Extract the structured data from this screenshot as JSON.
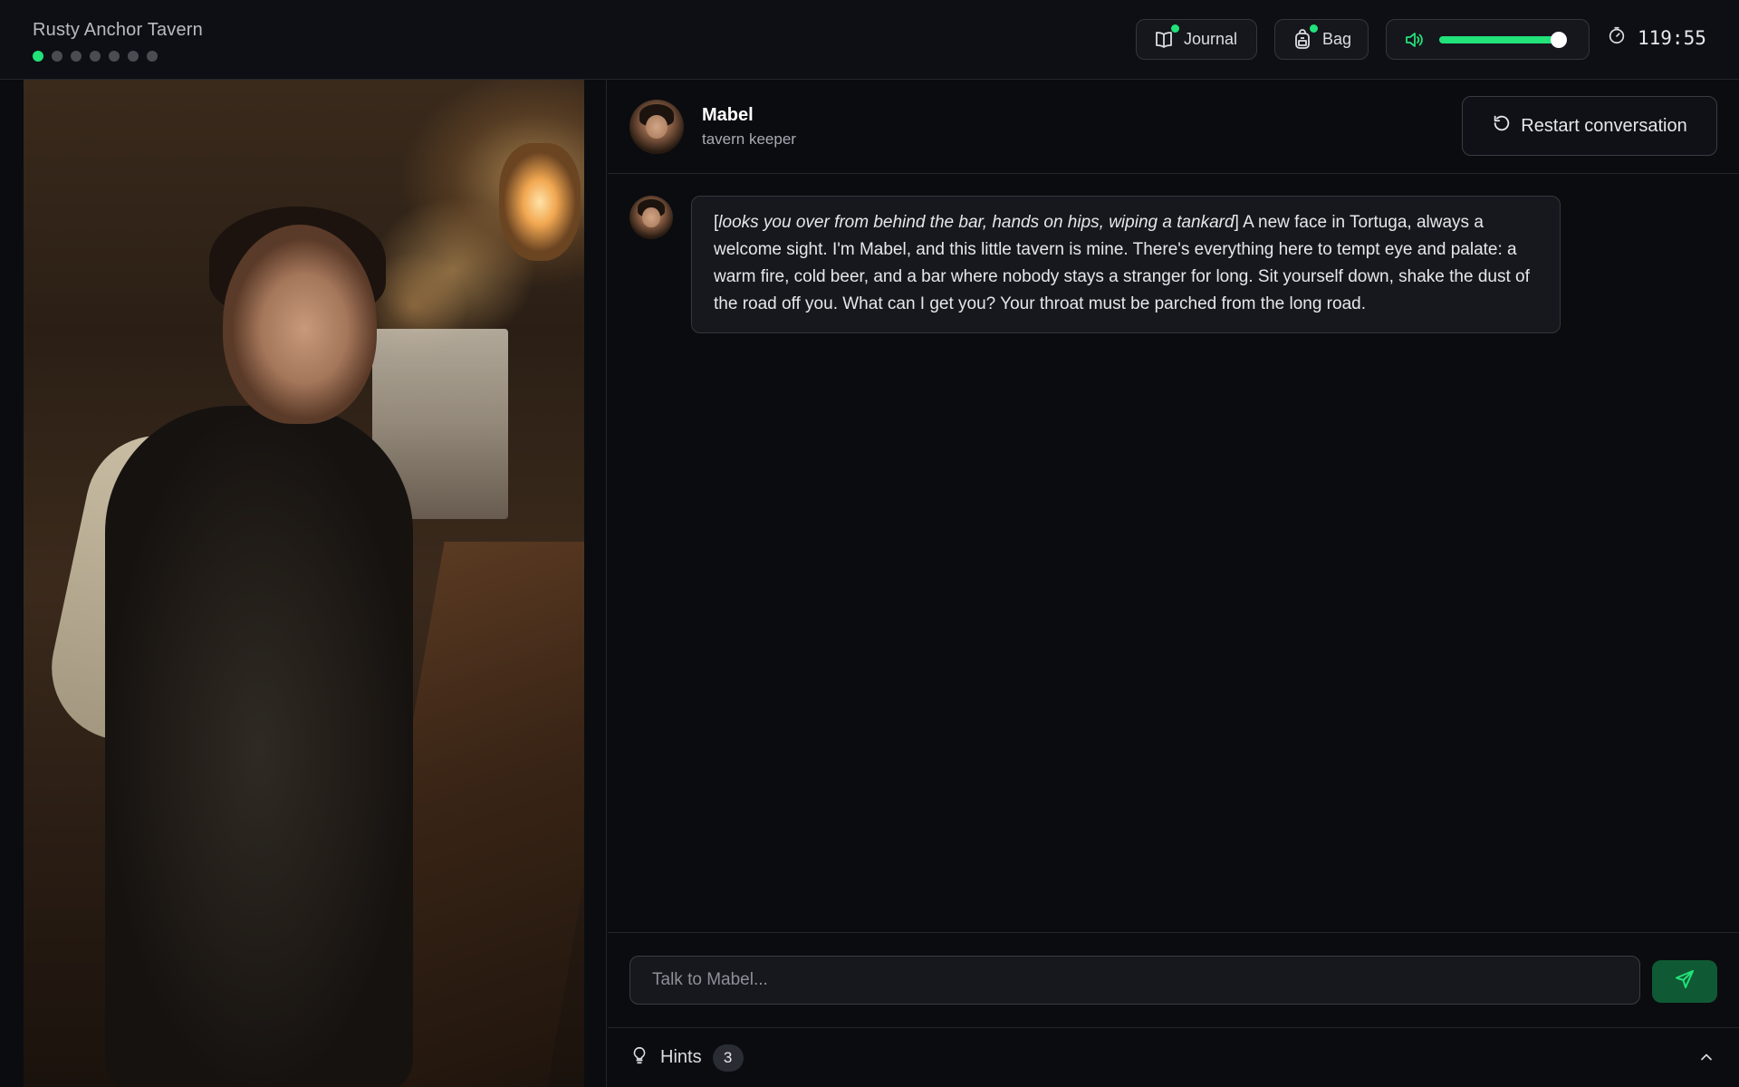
{
  "header": {
    "title": "Rusty Anchor Tavern",
    "progress_steps": 7,
    "progress_active": 1,
    "journal": {
      "label": "Journal",
      "icon": "book-icon",
      "has_notification": true
    },
    "bag": {
      "label": "Bag",
      "icon": "backpack-icon",
      "has_notification": true
    },
    "volume": {
      "icon": "speaker-icon",
      "level": 1.0
    },
    "timer": {
      "icon": "stopwatch-icon",
      "value": "119:55"
    }
  },
  "character": {
    "name": "Mabel",
    "role": "tavern keeper"
  },
  "conversation": {
    "restart_label": "Restart conversation",
    "messages": [
      {
        "sender": "Mabel",
        "action": "looks you over from behind the bar, hands on hips, wiping a tankard",
        "text": "A new face in Tortuga, always a welcome sight. I'm Mabel, and this little tavern is mine. There's everything here to tempt eye and palate: a warm fire, cold beer, and a bar where nobody stays a stranger for long. Sit yourself down, shake the dust of the road off you. What can I get you? Your throat must be parched from the long road."
      }
    ]
  },
  "composer": {
    "placeholder": "Talk to Mabel...",
    "value": ""
  },
  "hints": {
    "label": "Hints",
    "count": "3"
  },
  "colors": {
    "accent": "#22e27a",
    "send_button": "#0f5a34",
    "background": "#0b0c10"
  }
}
